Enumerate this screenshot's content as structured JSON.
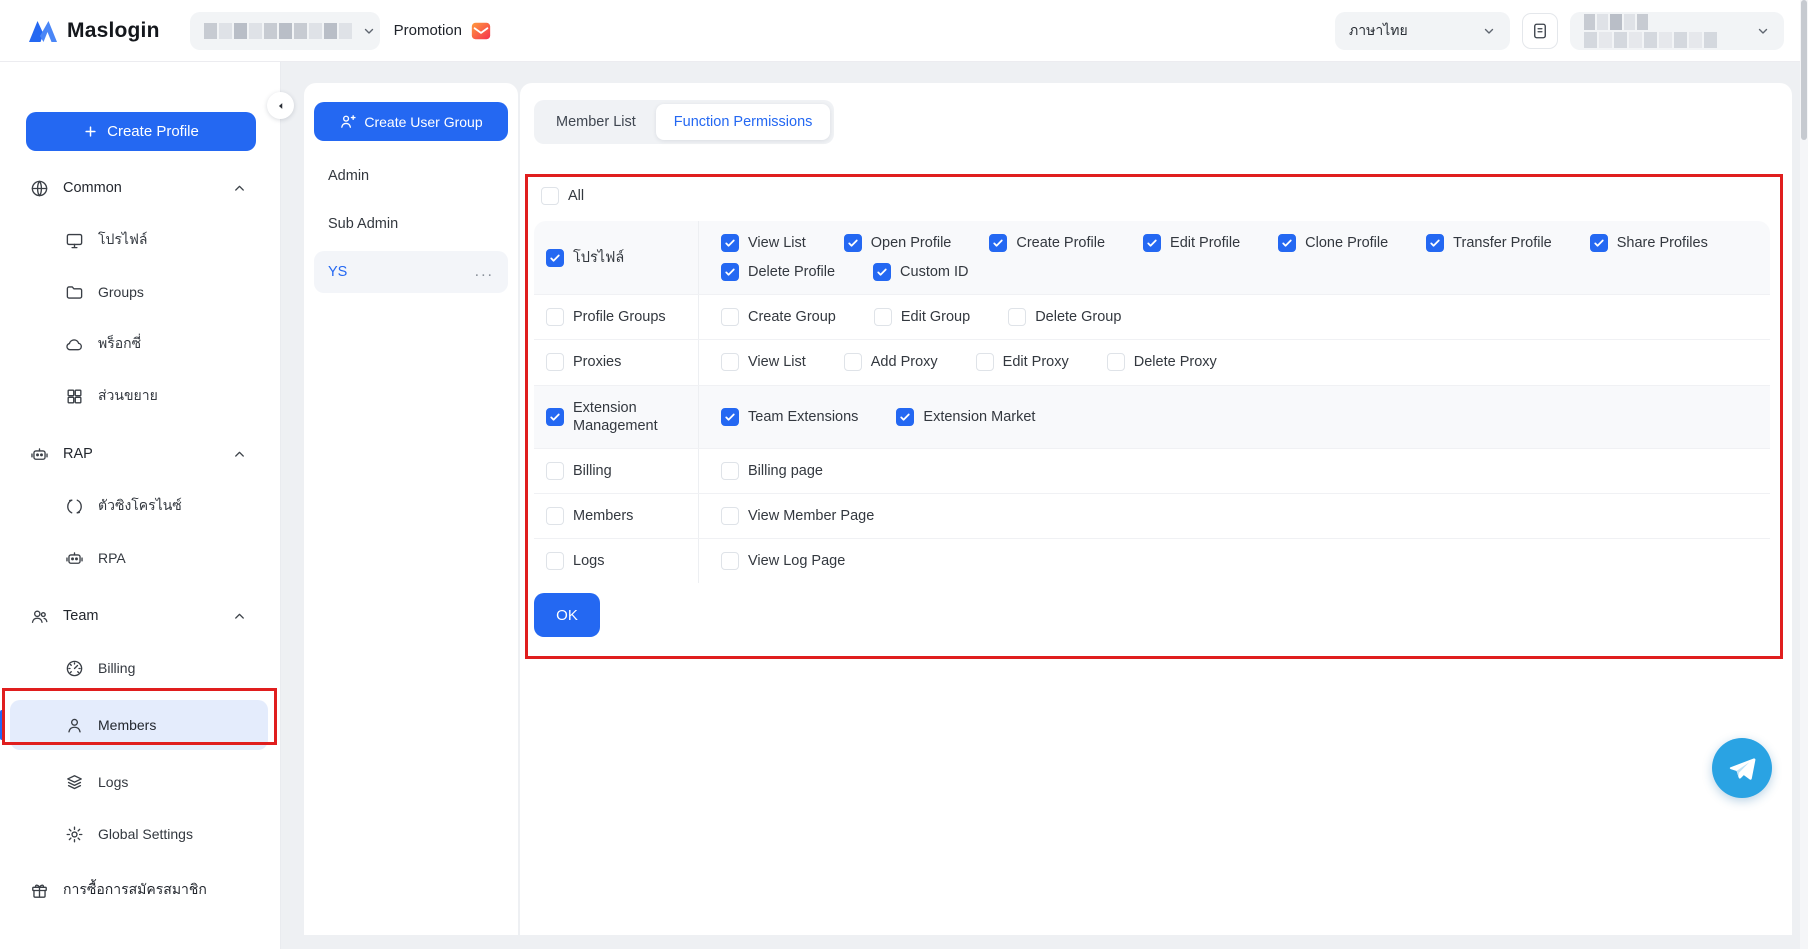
{
  "header": {
    "brand": "Maslogin",
    "promotion_label": "Promotion",
    "language_label": "ภาษาไทย"
  },
  "sidebar": {
    "create_profile_label": "Create Profile",
    "sections": [
      {
        "label": "Common",
        "icon": "globe-icon",
        "expanded": true,
        "items": [
          {
            "label": "โปรไฟล์",
            "icon": "monitor-icon"
          },
          {
            "label": "Groups",
            "icon": "folder-icon"
          },
          {
            "label": "พร็อกซี่",
            "icon": "cloud-icon"
          },
          {
            "label": "ส่วนขยาย",
            "icon": "grid-icon"
          }
        ]
      },
      {
        "label": "RAP",
        "icon": "robot-icon",
        "expanded": true,
        "items": [
          {
            "label": "ตัวซิงโครไนซ์",
            "icon": "sync-icon"
          },
          {
            "label": "RPA",
            "icon": "robot-icon"
          }
        ]
      },
      {
        "label": "Team",
        "icon": "people-icon",
        "expanded": true,
        "items": [
          {
            "label": "Billing",
            "icon": "meter-icon"
          },
          {
            "label": "Members",
            "icon": "person-icon",
            "active": true,
            "annotated": true
          },
          {
            "label": "Logs",
            "icon": "layers-icon"
          },
          {
            "label": "Global Settings",
            "icon": "gear-icon"
          }
        ]
      }
    ],
    "footer_item": {
      "label": "การซื้อการสมัครสมาชิก",
      "icon": "gift-icon"
    }
  },
  "groups_panel": {
    "create_button_label": "Create User Group",
    "groups": [
      {
        "name": "Admin",
        "selected": false
      },
      {
        "name": "Sub Admin",
        "selected": false
      },
      {
        "name": "YS",
        "selected": true,
        "menu": "..."
      }
    ]
  },
  "main": {
    "tabs": [
      {
        "label": "Member List",
        "active": false
      },
      {
        "label": "Function Permissions",
        "active": true
      }
    ],
    "all_label": "All",
    "all_checked": false,
    "ok_label": "OK",
    "permission_rows": [
      {
        "label": "โปรไฟล์",
        "checked": true,
        "highlight": true,
        "lines": [
          [
            {
              "label": "View List",
              "checked": true
            },
            {
              "label": "Open Profile",
              "checked": true
            },
            {
              "label": "Create Profile",
              "checked": true
            },
            {
              "label": "Edit Profile",
              "checked": true
            },
            {
              "label": "Clone Profile",
              "checked": true
            },
            {
              "label": "Transfer Profile",
              "checked": true
            },
            {
              "label": "Share Profiles",
              "checked": true
            }
          ],
          [
            {
              "label": "Delete Profile",
              "checked": true
            },
            {
              "label": "Custom ID",
              "checked": true
            }
          ]
        ]
      },
      {
        "label": "Profile Groups",
        "checked": false,
        "highlight": false,
        "lines": [
          [
            {
              "label": "Create Group",
              "checked": false
            },
            {
              "label": "Edit Group",
              "checked": false
            },
            {
              "label": "Delete Group",
              "checked": false
            }
          ]
        ]
      },
      {
        "label": "Proxies",
        "checked": false,
        "highlight": false,
        "lines": [
          [
            {
              "label": "View List",
              "checked": false
            },
            {
              "label": "Add Proxy",
              "checked": false
            },
            {
              "label": "Edit Proxy",
              "checked": false
            },
            {
              "label": "Delete Proxy",
              "checked": false
            }
          ]
        ]
      },
      {
        "label": "Extension Management",
        "checked": true,
        "highlight": true,
        "lines": [
          [
            {
              "label": "Team Extensions",
              "checked": true
            },
            {
              "label": "Extension Market",
              "checked": true
            }
          ]
        ]
      },
      {
        "label": "Billing",
        "checked": false,
        "highlight": false,
        "lines": [
          [
            {
              "label": "Billing page",
              "checked": false
            }
          ]
        ]
      },
      {
        "label": "Members",
        "checked": false,
        "highlight": false,
        "lines": [
          [
            {
              "label": "View Member Page",
              "checked": false
            }
          ]
        ]
      },
      {
        "label": "Logs",
        "checked": false,
        "highlight": false,
        "lines": [
          [
            {
              "label": "View Log Page",
              "checked": false
            }
          ]
        ]
      }
    ]
  },
  "colors": {
    "brand_blue": "#2468F2",
    "annotation_red": "#E01E1E",
    "active_item_bg": "#E4ECFC",
    "telegram_blue": "#2AA3E3",
    "page_bg": "#EEF0F3"
  }
}
